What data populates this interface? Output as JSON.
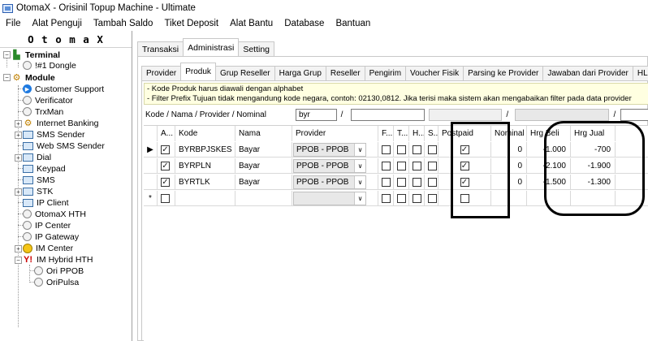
{
  "window": {
    "title": "OtomaX - Orisinil Topup Machine - Ultimate"
  },
  "menu": [
    "File",
    "Alat Penguji",
    "Tambah Saldo",
    "Tiket Deposit",
    "Alat Bantu",
    "Database",
    "Bantuan"
  ],
  "brand": "O t o m a X",
  "tree": {
    "terminal": "Terminal",
    "dongle": "!#1 Dongle",
    "module": "Module",
    "customer_support": "Customer Support",
    "verificator": "Verificator",
    "trxman": "TrxMan",
    "internet_banking": "Internet Banking",
    "sms_sender": "SMS Sender",
    "web_sms_sender": "Web SMS Sender",
    "dial": "Dial",
    "keypad": "Keypad",
    "sms": "SMS",
    "stk": "STK",
    "ip_client": "IP Client",
    "otomax_hth": "OtomaX HTH",
    "ip_center": "IP Center",
    "ip_gateway": "IP Gateway",
    "im_center": "IM Center",
    "im_hybrid_hth": "IM Hybrid HTH",
    "ori_ppob": "Ori PPOB",
    "oripulsa": "OriPulsa"
  },
  "main_tabs": {
    "transaksi": "Transaksi",
    "administrasi": "Administrasi",
    "setting": "Setting"
  },
  "sub_tabs": {
    "provider": "Provider",
    "produk": "Produk",
    "grup_reseller": "Grup Reseller",
    "harga_grup": "Harga Grup",
    "reseller": "Reseller",
    "pengirim": "Pengirim",
    "voucher_fisik": "Voucher Fisik",
    "parsing_ke_provider": "Parsing ke Provider",
    "jawaban_dari_provider": "Jawaban dari Provider",
    "hlr": "HLR"
  },
  "note": {
    "line1": "- Kode Produk harus diawali dengan alphabet",
    "line2": "- Filter Prefix Tujuan tidak mengandung kode negara, contoh: 02130,0812. Jika terisi maka sistem akan mengabaikan filter pada data provider"
  },
  "filter": {
    "label": "Kode / Nama / Provider / Nominal",
    "value": "byr",
    "sep1": "/",
    "sep2": "/",
    "sep3": "/"
  },
  "grid": {
    "headers": {
      "a": "A...",
      "kode": "Kode",
      "nama": "Nama",
      "provider": "Provider",
      "f": "F...",
      "t": "T...",
      "h": "H...",
      "s": "S...",
      "postpaid": "Postpaid",
      "nominal": "Nominal",
      "hrg_beli": "Hrg Beli",
      "hrg_jual": "Hrg Jual"
    },
    "rows": [
      {
        "indicator": "▶",
        "active": true,
        "kode": "BYRBPJSKES",
        "nama": "Bayar",
        "provider": "PPOB - PPOB",
        "postpaid": true,
        "nominal": "0",
        "hrg_beli": "-1.000",
        "hrg_jual": "-700"
      },
      {
        "indicator": "",
        "active": true,
        "kode": "BYRPLN",
        "nama": "Bayar",
        "provider": "PPOB - PPOB",
        "postpaid": true,
        "nominal": "0",
        "hrg_beli": "-2.100",
        "hrg_jual": "-1.900"
      },
      {
        "indicator": "",
        "active": true,
        "kode": "BYRTLK",
        "nama": "Bayar",
        "provider": "PPOB - PPOB",
        "postpaid": true,
        "nominal": "0",
        "hrg_beli": "-1.500",
        "hrg_jual": "-1.300"
      },
      {
        "indicator": "*",
        "active": false,
        "kode": "",
        "nama": "",
        "provider": "",
        "postpaid": false,
        "nominal": "",
        "hrg_beli": "",
        "hrg_jual": ""
      }
    ]
  }
}
